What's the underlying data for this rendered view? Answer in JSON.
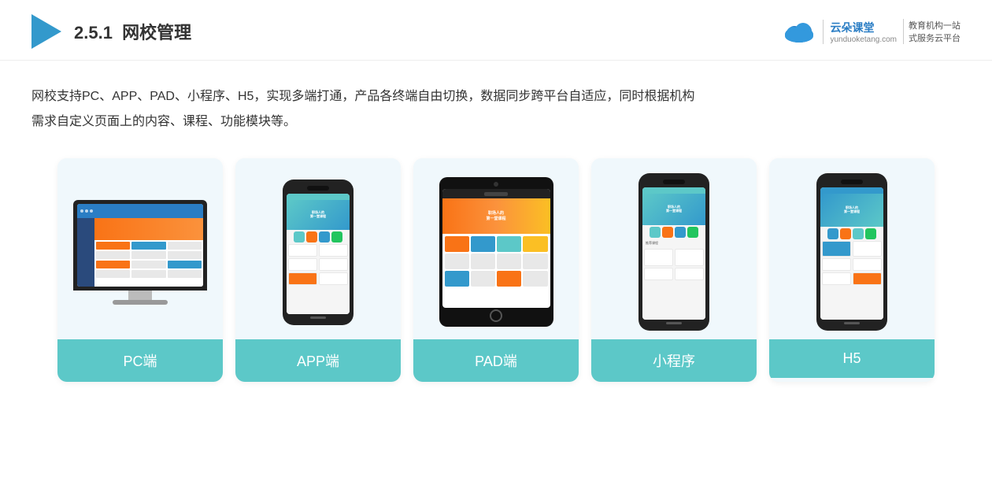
{
  "header": {
    "section_number": "2.5.1",
    "title_plain": "网校管理",
    "brand_name": "云朵课堂",
    "brand_domain": "yunduoketang.com",
    "brand_slogan1": "教育机构一站",
    "brand_slogan2": "式服务云平台"
  },
  "description": {
    "line1": "网校支持PC、APP、PAD、小程序、H5，实现多端打通，产品各终端自由切换，数据同步跨平台自适应，同时根据机构",
    "line2": "需求自定义页面上的内容、课程、功能模块等。"
  },
  "cards": [
    {
      "id": "pc",
      "label": "PC端"
    },
    {
      "id": "app",
      "label": "APP端"
    },
    {
      "id": "pad",
      "label": "PAD端"
    },
    {
      "id": "miniprogram",
      "label": "小程序"
    },
    {
      "id": "h5",
      "label": "H5"
    }
  ]
}
